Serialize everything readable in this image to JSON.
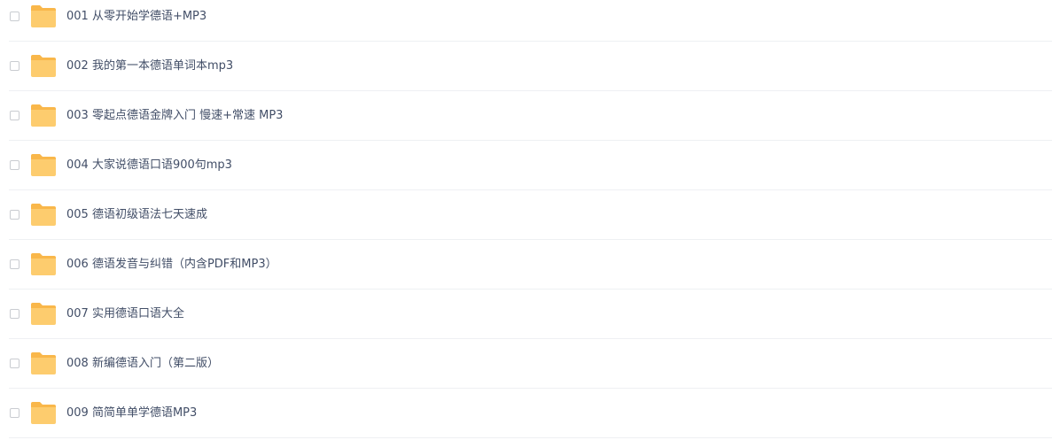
{
  "files": [
    {
      "name": "001 从零开始学德语+MP3"
    },
    {
      "name": "002 我的第一本德语单词本mp3"
    },
    {
      "name": "003 零起点德语金牌入门 慢速+常速 MP3"
    },
    {
      "name": "004 大家说德语口语900句mp3"
    },
    {
      "name": "005 德语初级语法七天速成"
    },
    {
      "name": "006 德语发音与纠错（内含PDF和MP3）"
    },
    {
      "name": "007 实用德语口语大全"
    },
    {
      "name": "008 新编德语入门（第二版）"
    },
    {
      "name": "009 简简单单学德语MP3"
    }
  ],
  "icon": "folder-icon",
  "colors": {
    "folder_body": "#fdcc6e",
    "folder_tab": "#f9b74a",
    "text": "#424e67",
    "divider": "#eef0f3"
  }
}
